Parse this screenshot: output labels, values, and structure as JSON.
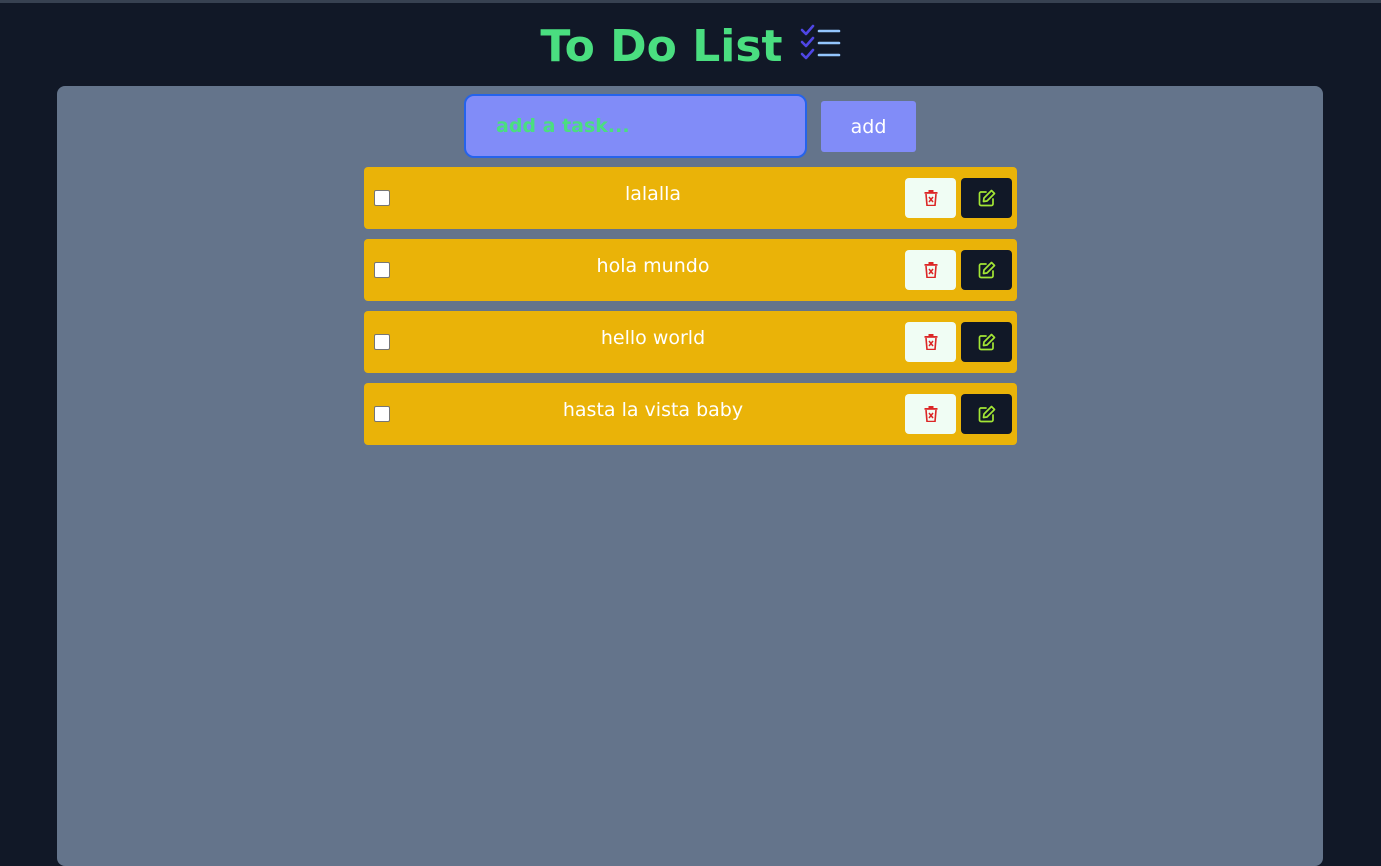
{
  "header": {
    "title": "To Do List",
    "icon": "checklist-icon"
  },
  "form": {
    "input_placeholder": "add a task...",
    "input_value": "",
    "add_label": "add"
  },
  "tasks": [
    {
      "text": "lalalla",
      "checked": false
    },
    {
      "text": "hola mundo",
      "checked": false
    },
    {
      "text": "hello world",
      "checked": false
    },
    {
      "text": "hasta la vista baby",
      "checked": false
    }
  ],
  "icons": {
    "delete": "trash-icon",
    "edit": "edit-icon"
  },
  "colors": {
    "background": "#111827",
    "panel": "#64748b",
    "title": "#4ade80",
    "input": "#818cf8",
    "task": "#eab308",
    "delete_bg": "#f0fdf4",
    "delete_icon": "#dc2626",
    "edit_bg": "#111827",
    "edit_icon": "#a3e635"
  }
}
